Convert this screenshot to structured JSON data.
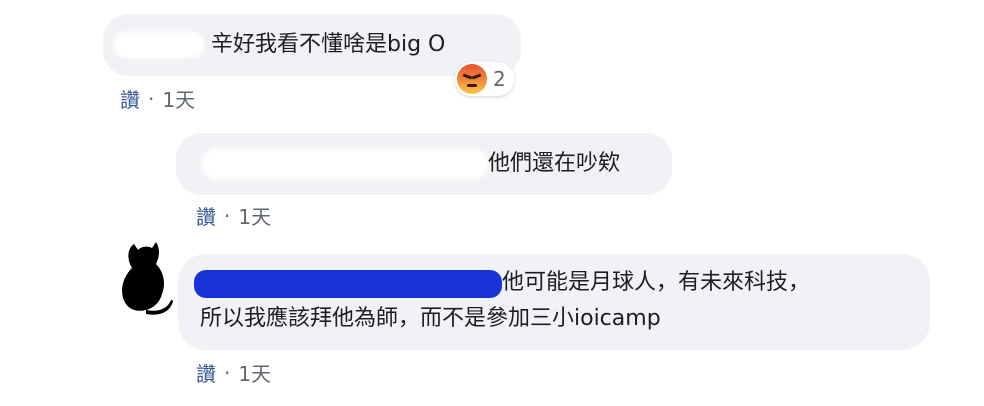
{
  "comments": [
    {
      "text": "辛好我看不懂啥是big O",
      "reaction": {
        "icon": "angry-reaction-icon",
        "count": "2"
      },
      "like_label": "讚",
      "time": "1天"
    },
    {
      "text": "他們還在吵欸",
      "like_label": "讚",
      "time": "1天"
    },
    {
      "text_line1": "他可能是月球人，有未來科技，",
      "text_line2": "所以我應該拜他為師，而不是參加三小ioicamp",
      "avatar_icon": "cat-silhouette-avatar",
      "like_label": "讚",
      "time": "1天"
    }
  ],
  "colors": {
    "bubble": "#f0f2f5",
    "link": "#385898",
    "muted": "#606770",
    "redaction": "#1a33d9"
  }
}
